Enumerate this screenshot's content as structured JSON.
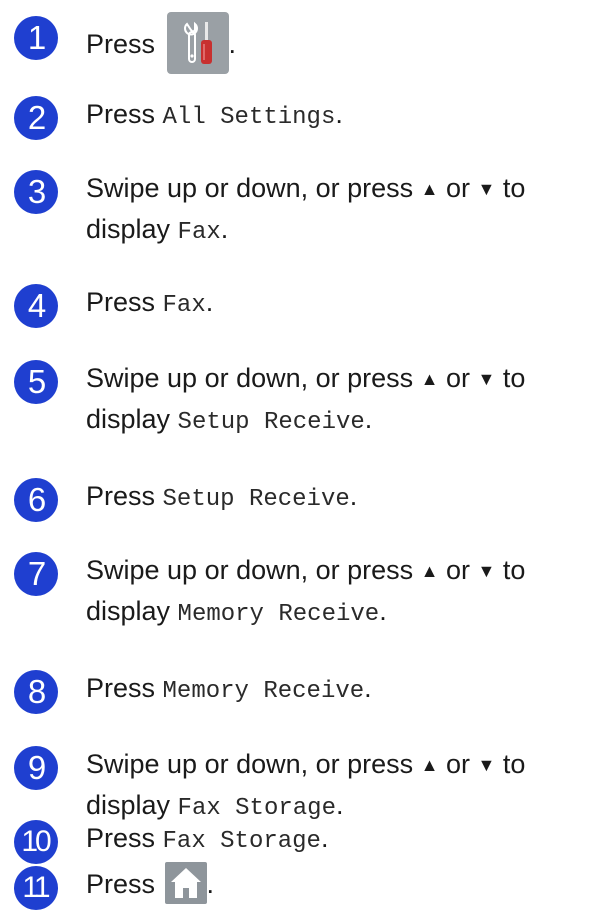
{
  "colors": {
    "badge": "#1f3fd0",
    "icon_bg": "#9aa0a5",
    "screwdriver_handle": "#c8302f"
  },
  "steps": [
    {
      "number": "1",
      "pre": "Press ",
      "icon": "settings-tools-icon",
      "post": "."
    },
    {
      "number": "2",
      "pre": "Press ",
      "code": "All Settings",
      "post": "."
    },
    {
      "number": "3",
      "line1": "Swipe up or down, or press ",
      "up": "▲",
      "mid": " or ",
      "down": "▼",
      "tail": " to",
      "pre2": "display ",
      "code": "Fax",
      "post": "."
    },
    {
      "number": "4",
      "pre": "Press ",
      "code": "Fax",
      "post": "."
    },
    {
      "number": "5",
      "line1": "Swipe up or down, or press ",
      "up": "▲",
      "mid": " or ",
      "down": "▼",
      "tail": " to",
      "pre2": "display ",
      "code": "Setup Receive",
      "post": "."
    },
    {
      "number": "6",
      "pre": "Press ",
      "code": "Setup Receive",
      "post": "."
    },
    {
      "number": "7",
      "line1": "Swipe up or down, or press ",
      "up": "▲",
      "mid": " or ",
      "down": "▼",
      "tail": " to",
      "pre2": "display ",
      "code": "Memory Receive",
      "post": "."
    },
    {
      "number": "8",
      "pre": "Press ",
      "code": "Memory Receive",
      "post": "."
    },
    {
      "number": "9",
      "line1": "Swipe up or down, or press ",
      "up": "▲",
      "mid": " or ",
      "down": "▼",
      "tail": " to",
      "pre2": "display ",
      "code": "Fax Storage",
      "post": "."
    },
    {
      "number": "10",
      "pre": "Press ",
      "code": "Fax Storage",
      "post": "."
    },
    {
      "number": "11",
      "pre": "Press ",
      "icon": "home-icon",
      "post": "."
    }
  ]
}
